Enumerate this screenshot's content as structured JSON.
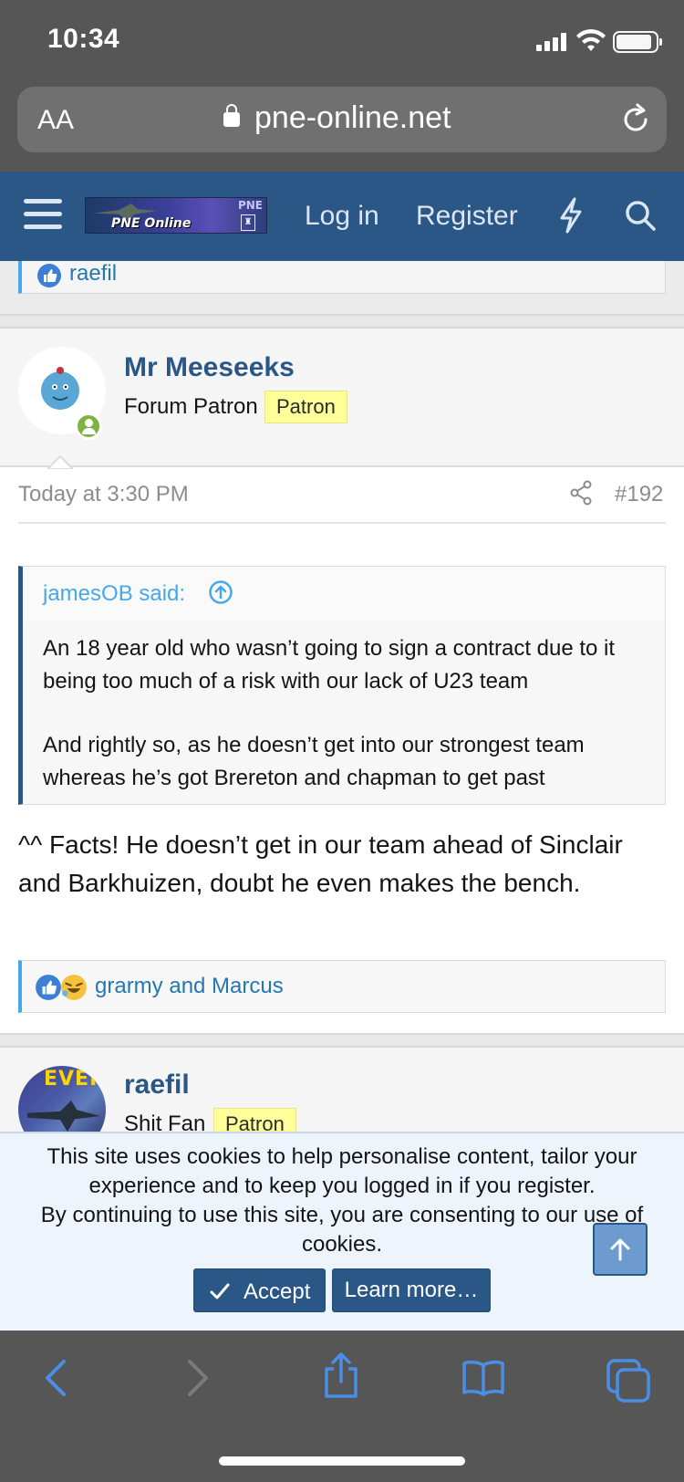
{
  "status_bar": {
    "time": "10:34"
  },
  "browser": {
    "text_size_label": "AA",
    "domain": "pne-online.net"
  },
  "header": {
    "logo_text": "PNE Online",
    "logo_tag": "PNE",
    "login_label": "Log in",
    "register_label": "Register"
  },
  "previous_post": {
    "reactions_text": "raefil"
  },
  "post": {
    "username": "Mr Meeseeks",
    "user_title": "Forum Patron",
    "badge": "Patron",
    "date": "Today at 3:30 PM",
    "post_number": "#192",
    "quote": {
      "author": "jamesOB said:",
      "paragraphs": [
        "An 18 year old who wasn’t going to sign a contract due to it being too much of a risk with our lack of U23 team",
        "And rightly so, as he doesn’t get into our strongest team whereas he’s got Brereton and chapman to get past"
      ]
    },
    "body": "^^ Facts! He doesn’t get in our team ahead of Sinclair and Barkhuizen, doubt he even makes the bench.",
    "reactions_text": "grarmy and Marcus"
  },
  "next_post": {
    "username": "raefil",
    "user_title": "Shit Fan",
    "badge": "Patron"
  },
  "cookie_notice": {
    "line1": "This site uses cookies to help personalise content, tailor your experience and to keep you logged in if you register.",
    "line2": "By continuing to use this site, you are consenting to our use of cookies.",
    "accept_label": "Accept",
    "learn_more_label": "Learn more…"
  },
  "colors": {
    "header_bg": "#2b5787",
    "link": "#2b5787",
    "quote_author": "#47a7eb",
    "badge_bg": "#ffff99",
    "browser_chrome": "#565656"
  }
}
